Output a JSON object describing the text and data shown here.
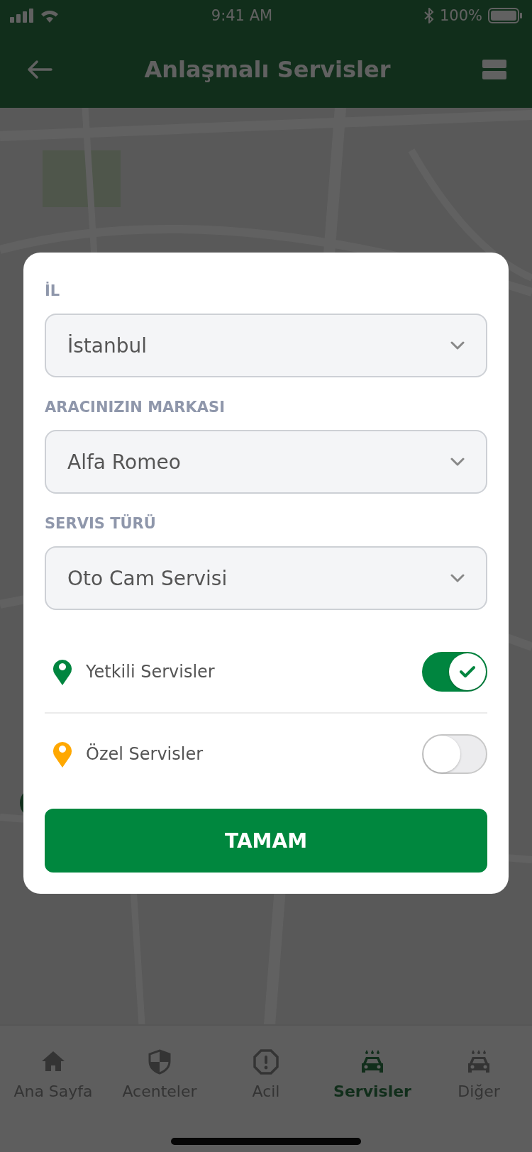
{
  "status_bar": {
    "time": "9:41 AM",
    "battery": "100%"
  },
  "header": {
    "title": "Anlaşmalı Servisler"
  },
  "modal": {
    "fields": [
      {
        "label": "İL",
        "value": "İstanbul"
      },
      {
        "label": "ARACINIZIN MARKASI",
        "value": "Alfa Romeo"
      },
      {
        "label": "SERVIS TÜRÜ",
        "value": "Oto Cam Servisi"
      }
    ],
    "toggles": [
      {
        "label": "Yetkili Servisler",
        "color": "#00853f",
        "on": true
      },
      {
        "label": "Özel Servisler",
        "color": "#ffa800",
        "on": false
      }
    ],
    "button": "TAMAM"
  },
  "tab_bar": [
    {
      "label": "Ana Sayfa",
      "kind": "home",
      "selected": false
    },
    {
      "label": "Acenteler",
      "kind": "shield",
      "selected": false
    },
    {
      "label": "Acil",
      "kind": "alert",
      "selected": false
    },
    {
      "label": "Servisler",
      "kind": "carwash",
      "selected": true
    },
    {
      "label": "Diğer",
      "kind": "carwash",
      "selected": false
    }
  ]
}
